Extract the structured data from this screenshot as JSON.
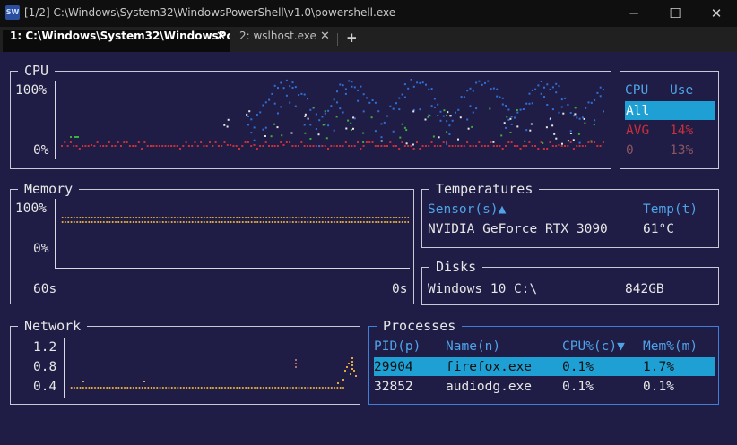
{
  "window": {
    "app_icon_text": "SW",
    "title": "[1/2] C:\\Windows\\System32\\WindowsPowerShell\\v1.0\\powershell.exe",
    "minimize_glyph": "─",
    "maximize_glyph": "☐",
    "close_glyph": "✕"
  },
  "tabs": [
    {
      "label": "1: C:\\Windows\\System32\\WindowsPow",
      "close": "✕"
    },
    {
      "label": "2: wslhost.exe",
      "close": "✕"
    }
  ],
  "new_tab_glyph": "+",
  "cpu": {
    "title": "CPU",
    "y_max": "100%",
    "y_min": "0%",
    "list_header_cpu": "CPU",
    "list_header_use": "Use",
    "rows": [
      {
        "name": "All",
        "use": ""
      },
      {
        "name": "AVG",
        "use": "14%"
      },
      {
        "name": "0",
        "use": "13%"
      }
    ]
  },
  "memory": {
    "title": "Memory",
    "y_max": "100%",
    "y_min": "0%",
    "x_left": "60s",
    "x_right": "0s"
  },
  "temperatures": {
    "title": "Temperatures",
    "col_sensor": "Sensor(s)▲",
    "col_temp": "Temp(t)",
    "rows": [
      {
        "sensor": "NVIDIA GeForce RTX 3090",
        "temp": "61°C"
      }
    ]
  },
  "disks": {
    "title": "Disks",
    "rows": [
      {
        "name": "Windows 10 C:\\",
        "size": "842GB"
      }
    ]
  },
  "network": {
    "title": "Network",
    "y_labels": [
      "1.2",
      "0.8",
      "0.4"
    ]
  },
  "processes": {
    "title": "Processes",
    "columns": [
      "PID(p)",
      "Name(n)",
      "CPU%(c)▼",
      "Mem%(m)"
    ],
    "rows": [
      {
        "pid": "29904",
        "name": "firefox.exe",
        "cpu": "0.1%",
        "mem": "1.7%"
      },
      {
        "pid": "32852",
        "name": "audiodg.exe",
        "cpu": "0.1%",
        "mem": "0.1%"
      }
    ]
  },
  "colors": {
    "background": "#1f1d45",
    "accent_blue": "#4fa3e8",
    "selection": "#1ea0d4",
    "cpu_all": "#2f6fd8",
    "cpu_avg": "#c8303a",
    "memory_line": "#e0a93a"
  }
}
